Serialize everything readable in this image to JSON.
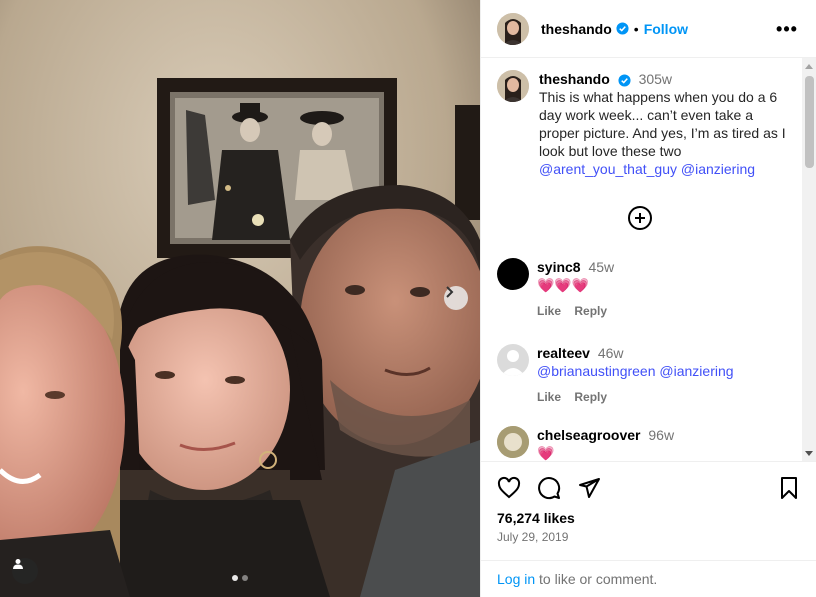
{
  "post": {
    "author": "theshando",
    "follow_label": "Follow",
    "separator": "•",
    "more_label": "•••"
  },
  "caption": {
    "username": "theshando",
    "time": "305w",
    "text": "This is what happens when you do a 6 day work week... can’t even take a proper picture. And yes, I’m as tired as I look but love these two",
    "mentions": [
      "@arent_you_that_guy",
      "@ianziering"
    ]
  },
  "comments": [
    {
      "username": "syinc8",
      "time": "45w",
      "text": "💗💗💗",
      "like_label": "Like",
      "reply_label": "Reply"
    },
    {
      "username": "realteev",
      "time": "46w",
      "text_mentions": [
        "@brianaustingreen",
        "@ianziering"
      ],
      "like_label": "Like",
      "reply_label": "Reply"
    },
    {
      "username": "chelseagroover",
      "time": "96w",
      "text": "💗"
    }
  ],
  "stats": {
    "likes": "76,274 likes",
    "date": "July 29, 2019"
  },
  "login": {
    "link": "Log in",
    "rest": " to like or comment."
  },
  "icons": {
    "like": "heart-outline-icon",
    "comment": "comment-bubble-icon",
    "share": "paper-plane-icon",
    "save": "bookmark-icon",
    "next": "chevron-right-icon",
    "user_tags": "person-icon",
    "add_comment": "plus-circle-icon",
    "verified": "verified-badge-icon"
  },
  "colors": {
    "accent": "#0095f6",
    "mention": "#4150f7",
    "verified": "#0095f6",
    "heart_emoji": "#f5308a"
  }
}
